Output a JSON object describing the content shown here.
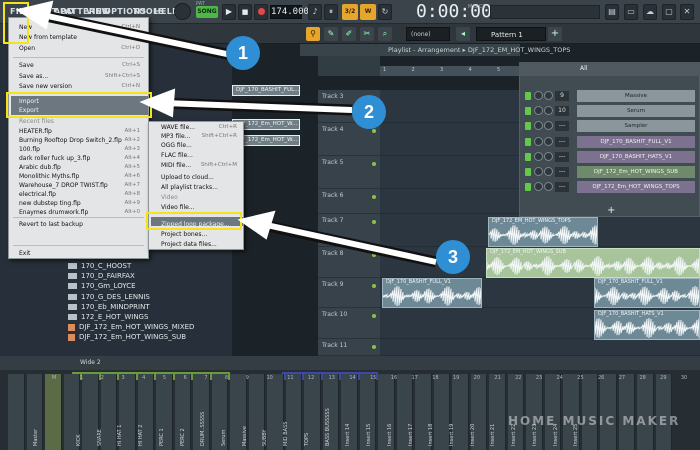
{
  "menubar": {
    "file": "FILE",
    "items": [
      "EDIT",
      "ADD",
      "PATTERNS",
      "VIEW",
      "OPTIONS",
      "TOOLS",
      "HELP"
    ]
  },
  "transport": {
    "pat_label": "PAT",
    "song_label": "SONG",
    "tempo": "174.000",
    "time": "0:00:00",
    "time_sub": "M:S:CS",
    "orange1": "3/2",
    "orange2": "W"
  },
  "toolbar2": {
    "snap": "(none)",
    "pattern": "Pattern 1"
  },
  "file_menu": {
    "items": [
      {
        "label": "New",
        "shortcut": "Ctrl+N"
      },
      {
        "label": "New from template",
        "shortcut": ""
      },
      {
        "label": "Open",
        "shortcut": "Ctrl+O"
      },
      {
        "label": "Save",
        "shortcut": "Ctrl+S"
      },
      {
        "label": "Save as...",
        "shortcut": "Shift+Ctrl+S"
      },
      {
        "label": "Save new version",
        "shortcut": "Ctrl+N"
      },
      {
        "label": "Import",
        "shortcut": ""
      },
      {
        "label": "Export",
        "shortcut": ""
      },
      {
        "label": "Recent files",
        "shortcut": ""
      },
      {
        "label": "HEATER.flp",
        "shortcut": "Alt+1"
      },
      {
        "label": "Burning Rooftop Drop Switch_2.flp",
        "shortcut": "Alt+2"
      },
      {
        "label": "100.flp",
        "shortcut": "Alt+3"
      },
      {
        "label": "dark roller fuck up_3.flp",
        "shortcut": "Alt+4"
      },
      {
        "label": "Arabic dub.flp",
        "shortcut": "Alt+5"
      },
      {
        "label": "Monolithic Myths.flp",
        "shortcut": "Alt+6"
      },
      {
        "label": "Warehouse_7 DROP TWIST.flp",
        "shortcut": "Alt+7"
      },
      {
        "label": "electrical.flp",
        "shortcut": "Alt+8"
      },
      {
        "label": "new dubstep ting.flp",
        "shortcut": "Alt+9"
      },
      {
        "label": "Enaymes drumwork.flp",
        "shortcut": "Alt+0"
      },
      {
        "label": "Revert to last backup",
        "shortcut": ""
      },
      {
        "label": "Exit",
        "shortcut": ""
      }
    ]
  },
  "export_menu": {
    "items": [
      {
        "label": "WAVE file...",
        "shortcut": "Ctrl+R"
      },
      {
        "label": "MP3 file...",
        "shortcut": "Shift+Ctrl+R"
      },
      {
        "label": "OGG file...",
        "shortcut": ""
      },
      {
        "label": "FLAC file...",
        "shortcut": ""
      },
      {
        "label": "MIDI file...",
        "shortcut": "Shift+Ctrl+M"
      },
      {
        "label": "Upload to cloud...",
        "shortcut": ""
      },
      {
        "label": "All playlist tracks...",
        "shortcut": ""
      },
      {
        "label": "Video",
        "shortcut": ""
      },
      {
        "label": "Video file...",
        "shortcut": ""
      },
      {
        "label": "Zipped loop package...",
        "shortcut": ""
      },
      {
        "label": "Project bones...",
        "shortcut": ""
      },
      {
        "label": "Project data files...",
        "shortcut": ""
      }
    ]
  },
  "channel_tabs": [
    "DJF_170_BASHIT_FUL...",
    "DJF_172_Em_HOT_W...",
    "DJF_172_Em_HOT_W..."
  ],
  "browser_items": [
    {
      "label": "170_C_HOOST",
      "type": "folder"
    },
    {
      "label": "170_D_FAIRFAX",
      "type": "folder"
    },
    {
      "label": "170_Gm_LOYCE",
      "type": "folder"
    },
    {
      "label": "170_G_DES_LENNIS",
      "type": "folder"
    },
    {
      "label": "170_Eb_MINDPRINT",
      "type": "folder"
    },
    {
      "label": "172_E_HOT_WINGS",
      "type": "folder"
    },
    {
      "label": "DJF_172_Em_HOT_WINGS_MIXED",
      "type": "file"
    },
    {
      "label": "DJF_172_Em_HOT_WINGS_SUB",
      "type": "file"
    }
  ],
  "playlist": {
    "title": "Playlist - Arrangement",
    "arrangement": "DJF_172_EM_HOT_WINGS_TOPS",
    "bars": [
      "1",
      "2",
      "3",
      "4",
      "5",
      "6",
      "7",
      "8",
      "9",
      "10",
      "11"
    ],
    "tracks": [
      "Track 3",
      "Track 4",
      "Track 5",
      "Track 6",
      "Track 7",
      "Track 8",
      "Track 9",
      "Track 10",
      "Track 11"
    ],
    "clips": [
      {
        "label": "DJF_172_EM_HOT_WINGS_TOPS"
      },
      {
        "label": "DJF_172_EM_HOT_WINGS_SUB"
      },
      {
        "label": "DJF_170_BASHIT_FULL_V1"
      },
      {
        "label": "DJF_170_BASHIT_FULL_V1"
      },
      {
        "label": "DJF_170_BASHIT_HATS_V1"
      }
    ]
  },
  "channel_rack": {
    "filter": "All",
    "rows": [
      {
        "num": "9",
        "name": "Massive"
      },
      {
        "num": "10",
        "name": "Serum"
      },
      {
        "num": "---",
        "name": "Sampler"
      },
      {
        "num": "---",
        "name": "DJF_170_BASHIT_FULL_V1"
      },
      {
        "num": "---",
        "name": "DJF_170_BASHIT_HATS_V1"
      },
      {
        "num": "---",
        "name": "DJF_172_Em_HOT_WINGS_SUB"
      },
      {
        "num": "---",
        "name": "DJF_172_Em_HOT_WINGS_TOPS"
      }
    ],
    "add": "+"
  },
  "mixer": {
    "view_label": "Wide 2",
    "numbers": [
      "M",
      "1",
      "2",
      "3",
      "4",
      "5",
      "6",
      "7",
      "8",
      "9",
      "10",
      "11",
      "12",
      "13",
      "14",
      "15",
      "16",
      "17",
      "18",
      "19",
      "20",
      "21",
      "22",
      "23",
      "24",
      "25",
      "26",
      "27",
      "28",
      "29",
      "30",
      "31",
      "32"
    ],
    "labels": [
      "Master",
      "KICK",
      "SNARE",
      "HI HAT 1",
      "HI HAT 2",
      "PERC 1",
      "PERC 2",
      "DRUM..SSSSS",
      "Serum",
      "Massive",
      "SUBBY",
      "MID BASS",
      "TOPS",
      "BASS BUSSSSS",
      "Insert 14",
      "Insert 15",
      "Insert 16",
      "Insert 17",
      "Insert 18",
      "Insert 19",
      "Insert 20",
      "Insert 21",
      "Insert 22",
      "Insert 23",
      "Insert 24",
      "Insert 25"
    ]
  },
  "callouts": [
    "1",
    "2",
    "3"
  ],
  "watermark": "HOME MUSIC MAKER",
  "colors": {
    "highlight_yellow": "#f4e31a",
    "callout_blue": "#2f8fd4",
    "song_green": "#4db848"
  }
}
